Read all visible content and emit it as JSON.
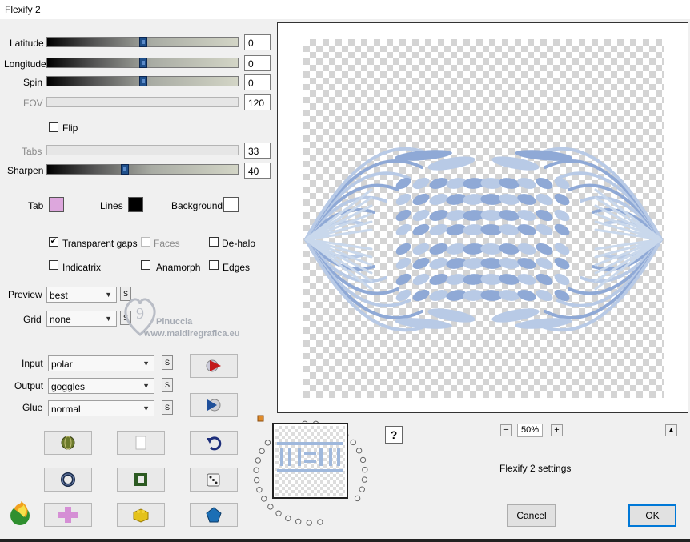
{
  "window": {
    "title": "Flexify 2"
  },
  "controls": {
    "latitude": {
      "label": "Latitude",
      "value": "0"
    },
    "longitude": {
      "label": "Longitude",
      "value": "0"
    },
    "spin": {
      "label": "Spin",
      "value": "0"
    },
    "fov": {
      "label": "FOV",
      "value": "120"
    },
    "flip": {
      "label": "Flip",
      "checked": false
    },
    "tabs": {
      "label": "Tabs",
      "value": "33"
    },
    "sharpen": {
      "label": "Sharpen",
      "value": "40"
    }
  },
  "colors": {
    "tab": {
      "label": "Tab",
      "color": "#dda7dd"
    },
    "lines": {
      "label": "Lines",
      "color": "#000000"
    },
    "background": {
      "label": "Background",
      "color": "#ffffff"
    }
  },
  "options": {
    "transparent_gaps": {
      "label": "Transparent gaps",
      "checked": true
    },
    "faces": {
      "label": "Faces",
      "checked": false
    },
    "de_halo": {
      "label": "De-halo",
      "checked": false
    },
    "indicatrix": {
      "label": "Indicatrix",
      "checked": false
    },
    "anamorph": {
      "label": "Anamorph",
      "checked": false
    },
    "edges": {
      "label": "Edges",
      "checked": false
    }
  },
  "dropdowns": {
    "preview": {
      "label": "Preview",
      "value": "best"
    },
    "grid": {
      "label": "Grid",
      "value": "none"
    },
    "input": {
      "label": "Input",
      "value": "polar"
    },
    "output": {
      "label": "Output",
      "value": "goggles"
    },
    "glue": {
      "label": "Glue",
      "value": "normal"
    },
    "s_label": "S"
  },
  "watermark": {
    "line1": "Pinuccia",
    "line2": "www.maidiregrafica.eu"
  },
  "zoom": {
    "value": "50%",
    "minus": "−",
    "plus": "+",
    "up": "▲"
  },
  "help_label": "?",
  "settings_label": "Flexify 2 settings",
  "buttons": {
    "cancel": "Cancel",
    "ok": "OK"
  },
  "icons": {
    "tool_row1": [
      "globe-icon",
      "page-icon",
      "undo-icon"
    ],
    "tool_row2": [
      "ring-icon",
      "square-icon",
      "dice-icon"
    ],
    "tool_row3": [
      "cross-icon",
      "brick-icon",
      "gem-icon"
    ],
    "side": [
      "play-red-icon",
      "play-blue-icon"
    ]
  }
}
